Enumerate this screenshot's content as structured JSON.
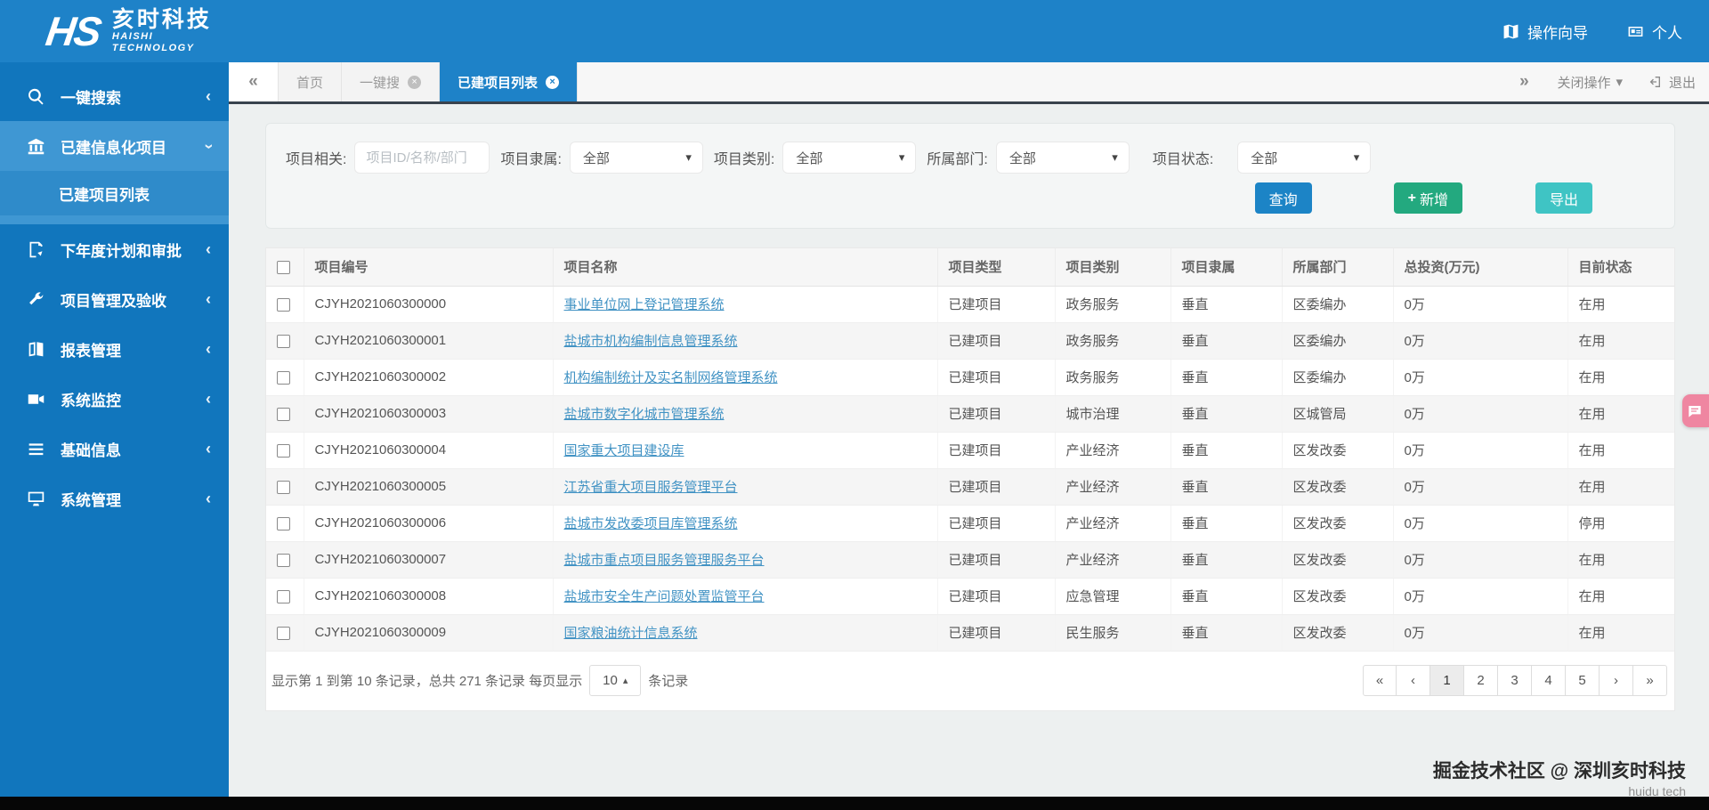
{
  "colors": {
    "primary": "#1e82c8",
    "sidebar": "#1176bd",
    "query-btn": "#1c84c6",
    "add-btn": "#23a97f",
    "export-btn": "#3fc4c4",
    "link": "#4293c4",
    "pink": "#ef86a1"
  },
  "icons": {
    "chevron_left": "‹",
    "caret_down": "▾",
    "caret_up": "▴",
    "double_left": "«",
    "double_right": "»",
    "close": "×",
    "plus": "+"
  },
  "header": {
    "logo_mark": "HS",
    "logo_cn": "亥时科技",
    "logo_en_1": "HAISHI",
    "logo_en_2": "TECHNOLOGY",
    "guide": "操作向导",
    "personal": "个人"
  },
  "sidebar": {
    "items": [
      {
        "icon": "search-icon",
        "label": "一键搜索"
      },
      {
        "icon": "bank-icon",
        "label": "已建信息化项目",
        "expanded": true,
        "children": [
          {
            "label": "已建项目列表",
            "active": true
          }
        ]
      },
      {
        "icon": "file-icon",
        "label": "下年度计划和审批"
      },
      {
        "icon": "wrench-icon",
        "label": "项目管理及验收"
      },
      {
        "icon": "book-icon",
        "label": "报表管理"
      },
      {
        "icon": "camera-icon",
        "label": "系统监控"
      },
      {
        "icon": "list-icon",
        "label": "基础信息"
      },
      {
        "icon": "desktop-icon",
        "label": "系统管理"
      }
    ]
  },
  "tabbar": {
    "tabs": [
      {
        "label": "首页",
        "closable": false,
        "active": false
      },
      {
        "label": "一键搜",
        "closable": true,
        "active": false
      },
      {
        "label": "已建项目列表",
        "closable": true,
        "active": true
      }
    ],
    "close_ops": "关闭操作",
    "logout": "退出"
  },
  "filters": {
    "related_label": "项目相关:",
    "search_placeholder": "项目ID/名称/部门",
    "selects": [
      {
        "label": "项目隶属:",
        "value": "全部"
      },
      {
        "label": "项目类别:",
        "value": "全部"
      },
      {
        "label": "所属部门:",
        "value": "全部"
      },
      {
        "label": "项目状态:",
        "value": "全部"
      }
    ],
    "buttons": {
      "query": "查询",
      "add": "新增",
      "export": "导出"
    }
  },
  "table": {
    "columns": [
      "项目编号",
      "项目名称",
      "项目类型",
      "项目类别",
      "项目隶属",
      "所属部门",
      "总投资(万元)",
      "目前状态"
    ],
    "rows": [
      {
        "code": "CJYH2021060300000",
        "name": "事业单位网上登记管理系统",
        "type": "已建项目",
        "category": "政务服务",
        "belong": "垂直",
        "dept": "区委编办",
        "invest": "0万",
        "status": "在用"
      },
      {
        "code": "CJYH2021060300001",
        "name": "盐城市机构编制信息管理系统",
        "type": "已建项目",
        "category": "政务服务",
        "belong": "垂直",
        "dept": "区委编办",
        "invest": "0万",
        "status": "在用"
      },
      {
        "code": "CJYH2021060300002",
        "name": "机构编制统计及实名制网络管理系统",
        "type": "已建项目",
        "category": "政务服务",
        "belong": "垂直",
        "dept": "区委编办",
        "invest": "0万",
        "status": "在用"
      },
      {
        "code": "CJYH2021060300003",
        "name": "盐城市数字化城市管理系统",
        "type": "已建项目",
        "category": "城市治理",
        "belong": "垂直",
        "dept": "区城管局",
        "invest": "0万",
        "status": "在用"
      },
      {
        "code": "CJYH2021060300004",
        "name": "国家重大项目建设库",
        "type": "已建项目",
        "category": "产业经济",
        "belong": "垂直",
        "dept": "区发改委",
        "invest": "0万",
        "status": "在用"
      },
      {
        "code": "CJYH2021060300005",
        "name": "江苏省重大项目服务管理平台",
        "type": "已建项目",
        "category": "产业经济",
        "belong": "垂直",
        "dept": "区发改委",
        "invest": "0万",
        "status": "在用"
      },
      {
        "code": "CJYH2021060300006",
        "name": "盐城市发改委项目库管理系统",
        "type": "已建项目",
        "category": "产业经济",
        "belong": "垂直",
        "dept": "区发改委",
        "invest": "0万",
        "status": "停用"
      },
      {
        "code": "CJYH2021060300007",
        "name": "盐城市重点项目服务管理服务平台",
        "type": "已建项目",
        "category": "产业经济",
        "belong": "垂直",
        "dept": "区发改委",
        "invest": "0万",
        "status": "在用"
      },
      {
        "code": "CJYH2021060300008",
        "name": "盐城市安全生产问题处置监管平台",
        "type": "已建项目",
        "category": "应急管理",
        "belong": "垂直",
        "dept": "区发改委",
        "invest": "0万",
        "status": "在用"
      },
      {
        "code": "CJYH2021060300009",
        "name": "国家粮油统计信息系统",
        "type": "已建项目",
        "category": "民生服务",
        "belong": "垂直",
        "dept": "区发改委",
        "invest": "0万",
        "status": "在用"
      }
    ]
  },
  "pagination": {
    "summary_prefix": "显示第 1 到第 10 条记录，总共 271 条记录 每页显示",
    "page_size": "10",
    "summary_suffix": "条记录",
    "pages": [
      {
        "label": "«"
      },
      {
        "label": "‹"
      },
      {
        "label": "1",
        "active": true
      },
      {
        "label": "2"
      },
      {
        "label": "3"
      },
      {
        "label": "4"
      },
      {
        "label": "5"
      },
      {
        "label": "›"
      },
      {
        "label": "»"
      }
    ]
  },
  "footer": {
    "brand": "掘金技术社区 @ 深圳亥时科技",
    "sub": "huidu tech"
  }
}
